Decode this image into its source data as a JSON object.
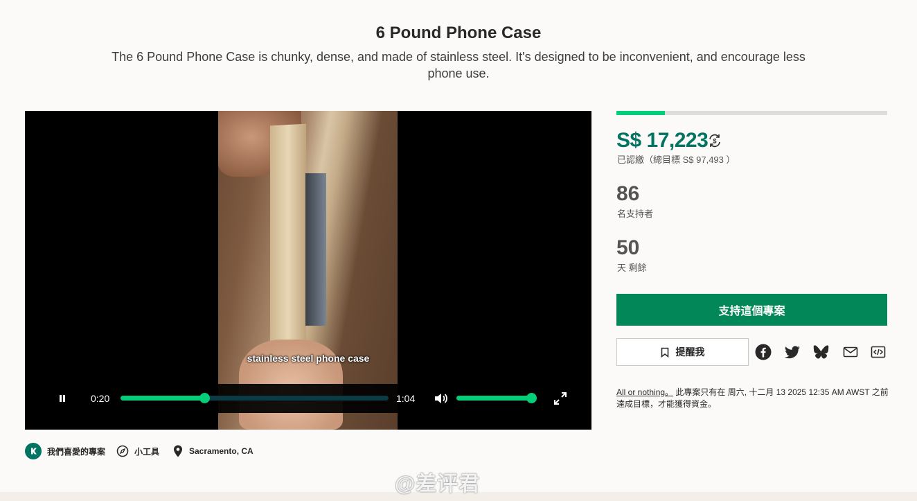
{
  "header": {
    "title": "6 Pound Phone Case",
    "blurb": "The 6 Pound Phone Case is chunky, dense, and made of stainless steel. It's designed to be inconvenient, and encourage less phone use."
  },
  "video": {
    "caption": "stainless steel phone case",
    "current_time": "0:20",
    "duration": "1:04",
    "playback_progress": 0.3125,
    "volume_level": 1.0
  },
  "campaign": {
    "funding_progress": 0.18,
    "pledged": "S$ 17,223",
    "goal_text": "已認繳（總目標 S$ 97,493 ）",
    "backers_count": "86",
    "backers_label": "名支持者",
    "days_left": "50",
    "days_left_label": "天 剩餘",
    "back_button": "支持這個專案",
    "remind_button": "提醒我",
    "all_or_nothing_link": "All or nothing。",
    "all_or_nothing_text": "此專案只有在 周六, 十二月 13 2025 12:35 AM AWST 之前達成目標，才能獲得資金。"
  },
  "meta": {
    "staff_pick": "我們喜愛的專案",
    "category": "小工具",
    "location": "Sacramento, CA"
  },
  "watermark": "@差评君",
  "colors": {
    "brand_green": "#028858",
    "pledged_green": "#037362",
    "progress_green": "#05ce78"
  }
}
